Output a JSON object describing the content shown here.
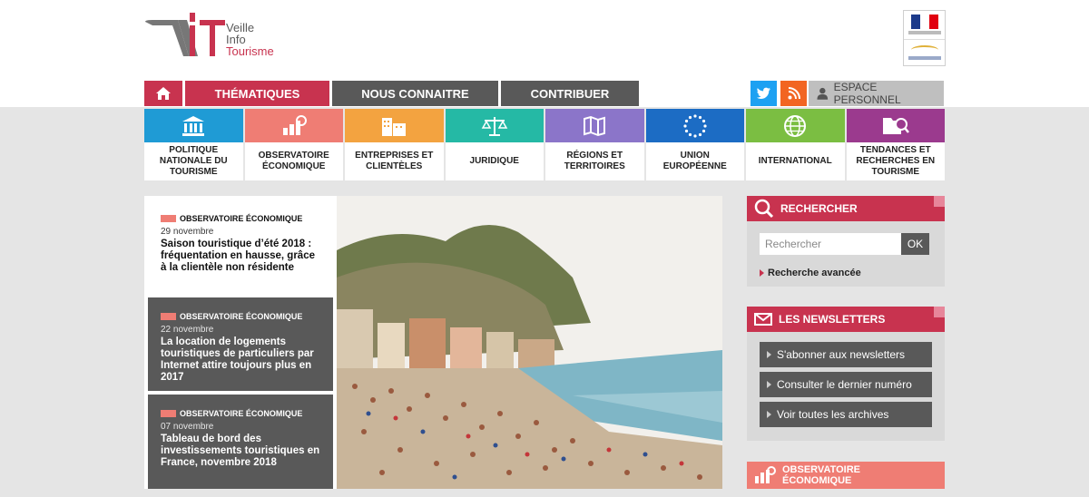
{
  "header": {
    "logo_word1": "Veille",
    "logo_word2": "Info",
    "logo_word3": "Tourisme"
  },
  "nav": {
    "home_icon": "home-icon",
    "items": [
      "THÉMATIQUES",
      "NOUS CONNAITRE",
      "CONTRIBUER"
    ],
    "espace": "ESPACE PERSONNEL"
  },
  "themes": [
    {
      "label": "POLITIQUE NATIONALE DU TOURISME",
      "color": "#1f9bd5",
      "icon": "institution-icon"
    },
    {
      "label": "OBSERVATOIRE ÉCONOMIQUE",
      "color": "#ef7d74",
      "icon": "chart-icon"
    },
    {
      "label": "ENTREPRISES ET CLIENTÈLES",
      "color": "#f3a340",
      "icon": "buildings-icon"
    },
    {
      "label": "JURIDIQUE",
      "color": "#25b9a5",
      "icon": "scales-icon"
    },
    {
      "label": "RÉGIONS ET TERRITOIRES",
      "color": "#8b75c9",
      "icon": "map-icon"
    },
    {
      "label": "UNION EUROPÉENNE",
      "color": "#1c6cc4",
      "icon": "eu-stars-icon"
    },
    {
      "label": "INTERNATIONAL",
      "color": "#7bbe42",
      "icon": "globe-icon"
    },
    {
      "label": "TENDANCES ET RECHERCHES EN TOURISME",
      "color": "#9b3a8e",
      "icon": "search-folder-icon"
    }
  ],
  "news": [
    {
      "category": "Observatoire économique",
      "date": "29 novembre",
      "title": "Saison touristique d’été 2018 : fréquentation en hausse, grâce à la clientèle non résidente"
    },
    {
      "category": "Observatoire économique",
      "date": "22 novembre",
      "title": "La location de logements touristiques de particuliers par Internet attire toujours plus en 2017"
    },
    {
      "category": "Observatoire économique",
      "date": "07 novembre",
      "title": "Tableau de bord des investissements touristiques en France, novembre 2018"
    }
  ],
  "search": {
    "heading": "RECHERCHER",
    "placeholder": "Rechercher",
    "ok": "OK",
    "advanced": "Recherche avancée"
  },
  "newsletters": {
    "heading": "LES NEWSLETTERS",
    "items": [
      "S'abonner aux newsletters",
      "Consulter le dernier numéro",
      "Voir toutes les archives"
    ]
  },
  "observatoire": {
    "heading_line1": "OBSERVATOIRE",
    "heading_line2": "ÉCONOMIQUE"
  },
  "colors": {
    "brand_red": "#c8334f",
    "dark_grey": "#595959",
    "salmon": "#ef7d74"
  }
}
